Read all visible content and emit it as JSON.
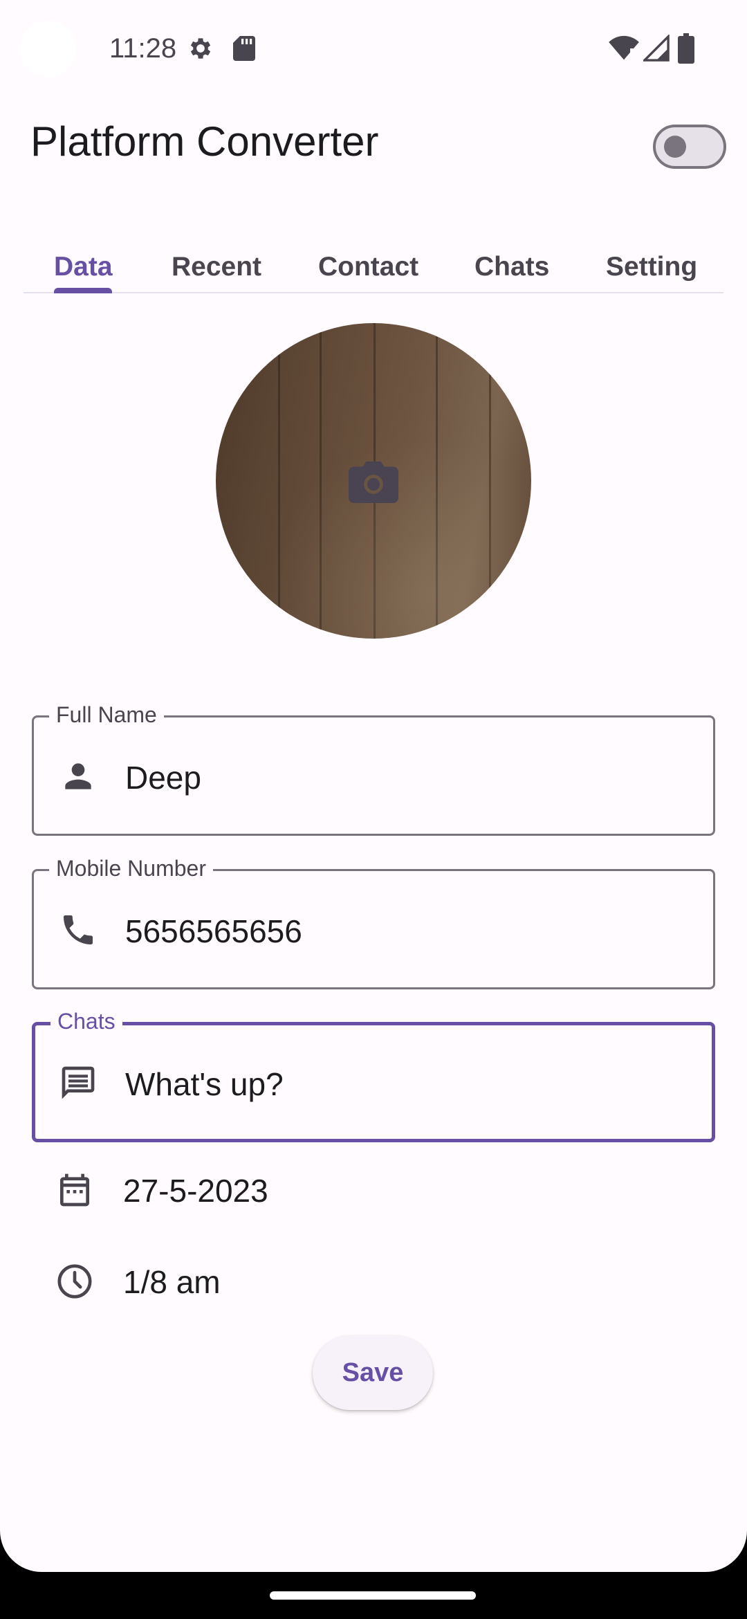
{
  "status_bar": {
    "time": "11:28",
    "icons": [
      "gear-icon",
      "sd-card-icon",
      "wifi-icon",
      "signal-icon",
      "battery-icon"
    ]
  },
  "app_bar": {
    "title": "Platform Converter",
    "theme_toggle_on": false
  },
  "tabs": [
    {
      "label": "Data",
      "active": true
    },
    {
      "label": "Recent",
      "active": false
    },
    {
      "label": "Contact",
      "active": false
    },
    {
      "label": "Chats",
      "active": false
    },
    {
      "label": "Setting",
      "active": false
    }
  ],
  "avatar": {
    "icon": "camera-icon"
  },
  "form": {
    "full_name": {
      "label": "Full Name",
      "value": "Deep",
      "icon": "person-icon"
    },
    "mobile": {
      "label": "Mobile Number",
      "value": "5656565656",
      "icon": "phone-icon"
    },
    "chats": {
      "label": "Chats",
      "value": "What's up?",
      "icon": "message-icon",
      "focused": true
    },
    "date": {
      "value": "27-5-2023",
      "icon": "calendar-icon"
    },
    "time": {
      "value": "1/8 am",
      "icon": "clock-icon"
    }
  },
  "save_label": "Save",
  "colors": {
    "accent": "#6750a4",
    "background": "#fffbfe",
    "outline": "#79747e",
    "text": "#1c1b1f"
  }
}
